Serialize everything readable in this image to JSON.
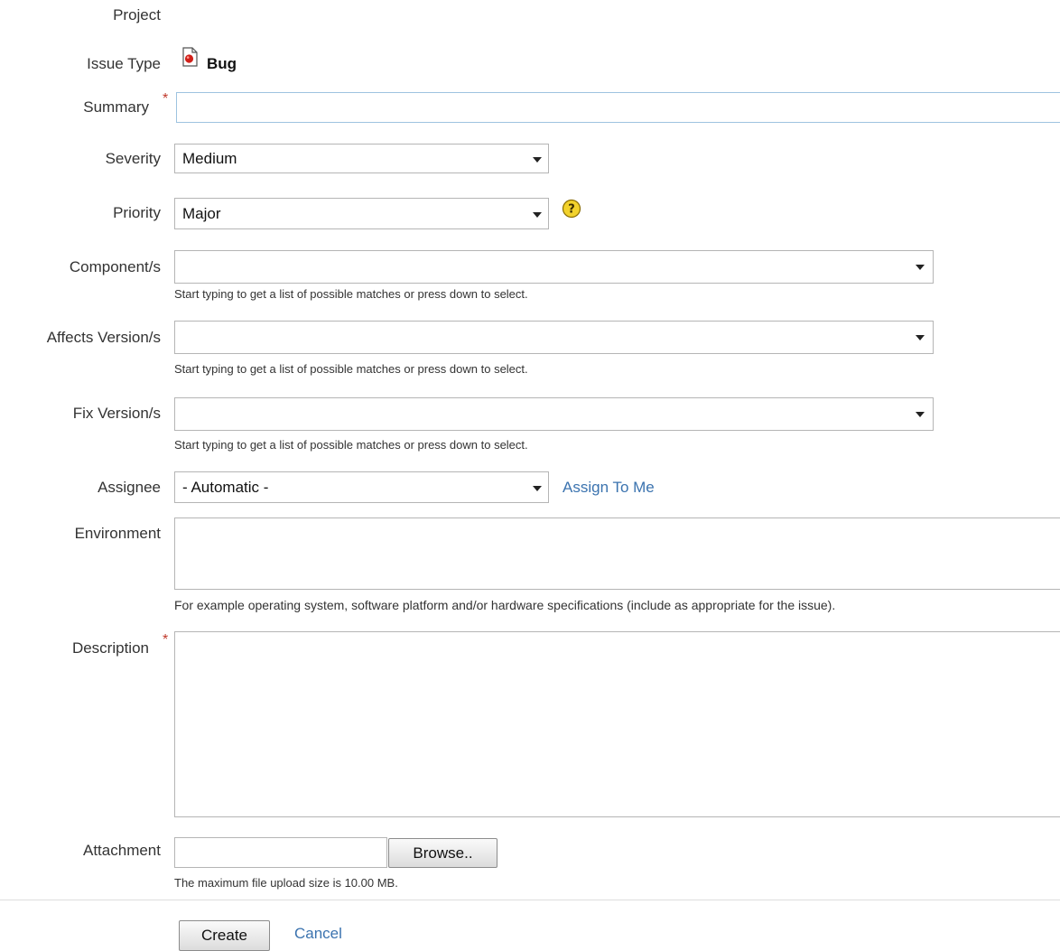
{
  "form": {
    "project_label": "Project",
    "issue_type_label": "Issue Type",
    "issue_type_value": "Bug",
    "summary_label": "Summary",
    "summary_value": "",
    "required_marker": "*",
    "severity_label": "Severity",
    "severity_value": "Medium",
    "priority_label": "Priority",
    "priority_value": "Major",
    "component_label": "Component/s",
    "component_hint": "Start typing to get a list of possible matches or press down to select.",
    "affects_label": "Affects Version/s",
    "affects_hint": "Start typing to get a list of possible matches or press down to select.",
    "fix_label": "Fix Version/s",
    "fix_hint": "Start typing to get a list of possible matches or press down to select.",
    "assignee_label": "Assignee",
    "assignee_value": "- Automatic -",
    "assign_to_me": "Assign To Me",
    "environment_label": "Environment",
    "environment_hint": "For example operating system, software platform and/or hardware specifications (include as appropriate for the issue).",
    "description_label": "Description",
    "attachment_label": "Attachment",
    "browse_label": "Browse..",
    "attachment_hint": "The maximum file upload size is 10.00 MB."
  },
  "actions": {
    "create_label": "Create",
    "cancel_label": "Cancel"
  },
  "icons": {
    "issue_type": "bug-icon",
    "priority_help": "help-icon"
  },
  "colors": {
    "link": "#3b73af",
    "required": "#c0392b",
    "bug": "#d0201a",
    "help": "#e8c21a"
  }
}
